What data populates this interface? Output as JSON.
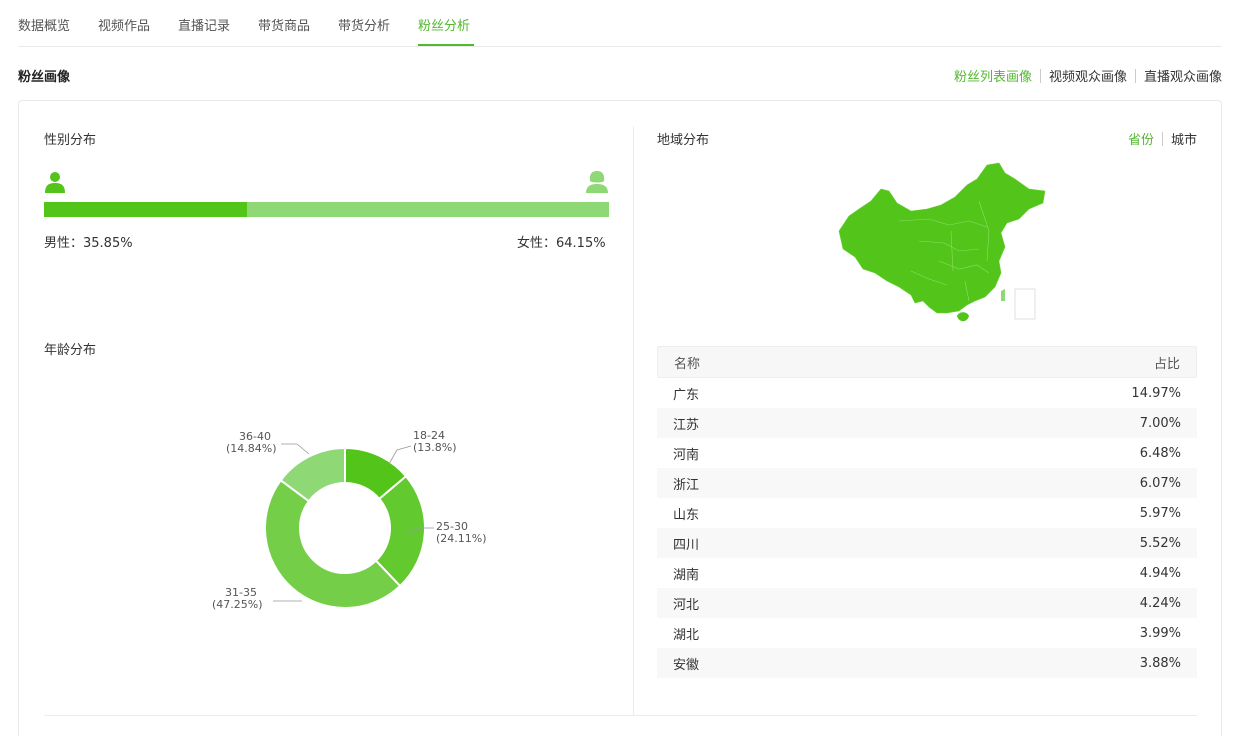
{
  "tabs": [
    "数据概览",
    "视频作品",
    "直播记录",
    "带货商品",
    "带货分析",
    "粉丝分析"
  ],
  "active_tab": "粉丝分析",
  "section_title": "粉丝画像",
  "view_options": [
    "粉丝列表画像",
    "视频观众画像",
    "直播观众画像"
  ],
  "active_view": "粉丝列表画像",
  "gender": {
    "title": "性别分布",
    "male_label": "男性：35.85%",
    "female_label": "女性：64.15%",
    "male_ratio": 0.3585,
    "colors": {
      "male": "#52c41a",
      "female": "#8ed876"
    }
  },
  "age": {
    "title": "年龄分布",
    "labels": [
      {
        "range": "18-24",
        "pct": "(13.8%)"
      },
      {
        "range": "25-30",
        "pct": "(24.11%)"
      },
      {
        "range": "31-35",
        "pct": "(47.25%)"
      },
      {
        "range": "36-40",
        "pct": "(14.84%)"
      }
    ]
  },
  "chart_data": {
    "type": "pie",
    "categories": [
      "18-24",
      "25-30",
      "31-35",
      "36-40"
    ],
    "values": [
      13.8,
      24.11,
      47.25,
      14.84
    ],
    "colors": [
      "#52c41a",
      "#62c92f",
      "#74ce48",
      "#8ed876"
    ]
  },
  "region": {
    "title": "地域分布",
    "switch_options": [
      "省份",
      "城市"
    ],
    "active_switch": "省份",
    "map_color": "#52c41a",
    "table_headers": [
      "名称",
      "占比"
    ],
    "rows": [
      {
        "name": "广东",
        "pct": "14.97%"
      },
      {
        "name": "江苏",
        "pct": "7.00%"
      },
      {
        "name": "河南",
        "pct": "6.48%"
      },
      {
        "name": "浙江",
        "pct": "6.07%"
      },
      {
        "name": "山东",
        "pct": "5.97%"
      },
      {
        "name": "四川",
        "pct": "5.52%"
      },
      {
        "name": "湖南",
        "pct": "4.94%"
      },
      {
        "name": "河北",
        "pct": "4.24%"
      },
      {
        "name": "湖北",
        "pct": "3.99%"
      },
      {
        "name": "安徽",
        "pct": "3.88%"
      }
    ]
  }
}
